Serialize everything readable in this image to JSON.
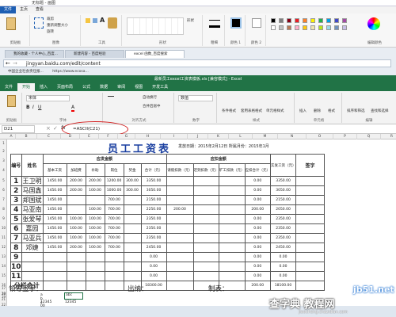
{
  "paint": {
    "title": "无标题 - 画图",
    "tabs": [
      "文件",
      "主页",
      "查看"
    ],
    "groups": [
      "剪贴板",
      "图像",
      "工具",
      "形状",
      "粗细",
      "颜色 1",
      "颜色 2",
      "编辑颜色"
    ],
    "buttons": {
      "crop": "裁剪",
      "resize": "重新调整大小",
      "rotate": "旋转",
      "select": "选择",
      "brush": "刷子",
      "shapes": "形状",
      "size": "粗细"
    },
    "colors": [
      "#000000",
      "#7f7f7f",
      "#880015",
      "#ed1c24",
      "#ff7f27",
      "#fff200",
      "#22b14c",
      "#00a2e8",
      "#3f48cc",
      "#a349a4",
      "#ffffff",
      "#c3c3c3",
      "#b97a57",
      "#ffaec9",
      "#ffc90e",
      "#efe4b0",
      "#b5e61d",
      "#99d9ea",
      "#7092be",
      "#c8bfe7"
    ]
  },
  "browser": {
    "tabs": [
      "我的收藏 - 个人中心_百度...",
      "新建内容 - 百度经验",
      "excel 函数_百度搜索"
    ],
    "url": "jingyan.baidu.com/edit/content",
    "bookmarks": [
      "中国企业社会责任报...",
      "https://www.ecosa..."
    ]
  },
  "excel": {
    "title": "最新员工excel工资表模板.xls [兼容模式] - Excel",
    "tabs": [
      "文件",
      "开始",
      "插入",
      "页面布局",
      "公式",
      "数据",
      "审阅",
      "视图",
      "开发工具"
    ],
    "ribbon": {
      "clipboard": "剪贴板",
      "font": "字体",
      "font_name": "宋体",
      "align": "对齐方式",
      "wrap": "自动换行",
      "merge": "合并后居中",
      "number": "数字",
      "number_format": "数值",
      "styles": "样式",
      "cond_fmt": "条件格式",
      "table_fmt": "套用表格格式",
      "cell_style": "单元格样式",
      "cells": "单元格",
      "insert": "插入",
      "delete": "删除",
      "format": "格式",
      "editing": "编辑",
      "sort": "排序和筛选",
      "find": "查找和选择"
    },
    "namebox": "D21",
    "formula": "=ASCII(C21)"
  },
  "sheet": {
    "col_headers": [
      "A",
      "B",
      "C",
      "D",
      "E",
      "F",
      "G",
      "H",
      "I",
      "J",
      "K",
      "L",
      "M",
      "N",
      "O",
      "P",
      "Q",
      "R"
    ],
    "row_headers": [
      "1",
      "2",
      "3",
      "4",
      "5",
      "6",
      "7",
      "8",
      "9",
      "10",
      "11",
      "12",
      "13",
      "14",
      "15",
      "16",
      "17",
      "18",
      "19",
      "20",
      "21",
      "22"
    ],
    "title": "员工工资表",
    "date": "发放日期：2015年2月12日  所属月份：2015年1月",
    "headers": {
      "no": "编号",
      "name": "姓名",
      "payable": "应发金额",
      "deduct": "应扣金额",
      "actual": "实发工资（元）",
      "sign": "签字",
      "basic": "基本工资",
      "overtime": "加班费",
      "subsidy": "补助",
      "post": "岗位",
      "bonus": "奖金",
      "total": "合计（元）",
      "leave": "请假扣款（元）",
      "late": "迟到扣款（元）",
      "absent": "旷工扣款（元）",
      "deduct_total": "应扣合计（元）"
    },
    "rows": [
      {
        "no": "1",
        "name": "王卫明",
        "basic": "1450.00",
        "overtime": "200.00",
        "subsidy": "200.00",
        "post": "1200.00",
        "bonus": "300.00",
        "total": "3350.00",
        "leave": "",
        "late": "",
        "absent": "",
        "dtotal": "0.00",
        "actual": "3350.00"
      },
      {
        "no": "2",
        "name": "马国鑫",
        "basic": "1450.00",
        "overtime": "200.00",
        "subsidy": "100.00",
        "post": "1000.00",
        "bonus": "300.00",
        "total": "3050.00",
        "leave": "",
        "late": "",
        "absent": "",
        "dtotal": "0.00",
        "actual": "3050.00"
      },
      {
        "no": "3",
        "name": "郑国斌",
        "basic": "1450.00",
        "overtime": "",
        "subsidy": "",
        "post": "700.00",
        "bonus": "",
        "total": "2150.00",
        "leave": "",
        "late": "",
        "absent": "",
        "dtotal": "0.00",
        "actual": "2150.00"
      },
      {
        "no": "4",
        "name": "马亚南",
        "basic": "1450.00",
        "overtime": "",
        "subsidy": "100.00",
        "post": "700.00",
        "bonus": "",
        "total": "2250.00",
        "leave": "200.00",
        "late": "",
        "absent": "",
        "dtotal": "200.00",
        "actual": "2050.00"
      },
      {
        "no": "5",
        "name": "张爱琴",
        "basic": "1450.00",
        "overtime": "100.00",
        "subsidy": "100.00",
        "post": "700.00",
        "bonus": "",
        "total": "2350.00",
        "leave": "",
        "late": "",
        "absent": "",
        "dtotal": "0.00",
        "actual": "2350.00"
      },
      {
        "no": "6",
        "name": "嘉园",
        "basic": "1450.00",
        "overtime": "100.00",
        "subsidy": "100.00",
        "post": "700.00",
        "bonus": "",
        "total": "2350.00",
        "leave": "",
        "late": "",
        "absent": "",
        "dtotal": "0.00",
        "actual": "2350.00"
      },
      {
        "no": "7",
        "name": "马亚兵",
        "basic": "1450.00",
        "overtime": "100.00",
        "subsidy": "100.00",
        "post": "700.00",
        "bonus": "",
        "total": "2350.00",
        "leave": "",
        "late": "",
        "absent": "",
        "dtotal": "0.00",
        "actual": "2350.00"
      },
      {
        "no": "8",
        "name": "邓婕",
        "basic": "1450.00",
        "overtime": "200.00",
        "subsidy": "100.00",
        "post": "700.00",
        "bonus": "",
        "total": "2450.00",
        "leave": "",
        "late": "",
        "absent": "",
        "dtotal": "0.00",
        "actual": "2450.00"
      },
      {
        "no": "9",
        "name": "",
        "basic": "",
        "overtime": "",
        "subsidy": "",
        "post": "",
        "bonus": "",
        "total": "0.00",
        "leave": "",
        "late": "",
        "absent": "",
        "dtotal": "0.00",
        "actual": "0.00"
      },
      {
        "no": "10",
        "name": "",
        "basic": "",
        "overtime": "",
        "subsidy": "",
        "post": "",
        "bonus": "",
        "total": "0.00",
        "leave": "",
        "late": "",
        "absent": "",
        "dtotal": "0.00",
        "actual": "0.00"
      },
      {
        "no": "11",
        "name": "",
        "basic": "",
        "overtime": "",
        "subsidy": "",
        "post": "",
        "bonus": "",
        "total": "0.00",
        "leave": "",
        "late": "",
        "absent": "",
        "dtotal": "0.00",
        "actual": "0.00"
      }
    ],
    "subtotal_label": "分栏合计",
    "subtotal_total": "18300.00",
    "subtotal_dtotal": "200.00",
    "subtotal_actual": "18100.00",
    "sign_leader": "领导签字：",
    "sign_cashier": "出纳：",
    "sign_maker": "制表：",
    "row21_c": "a b c",
    "row21_d": "abc",
    "row22_c": "12345 00",
    "row22_d": "12345"
  },
  "watermark": {
    "line1": "jb51.net",
    "line2": "查字典 教程网",
    "line3": "jiaocheng.chazidian.com"
  }
}
